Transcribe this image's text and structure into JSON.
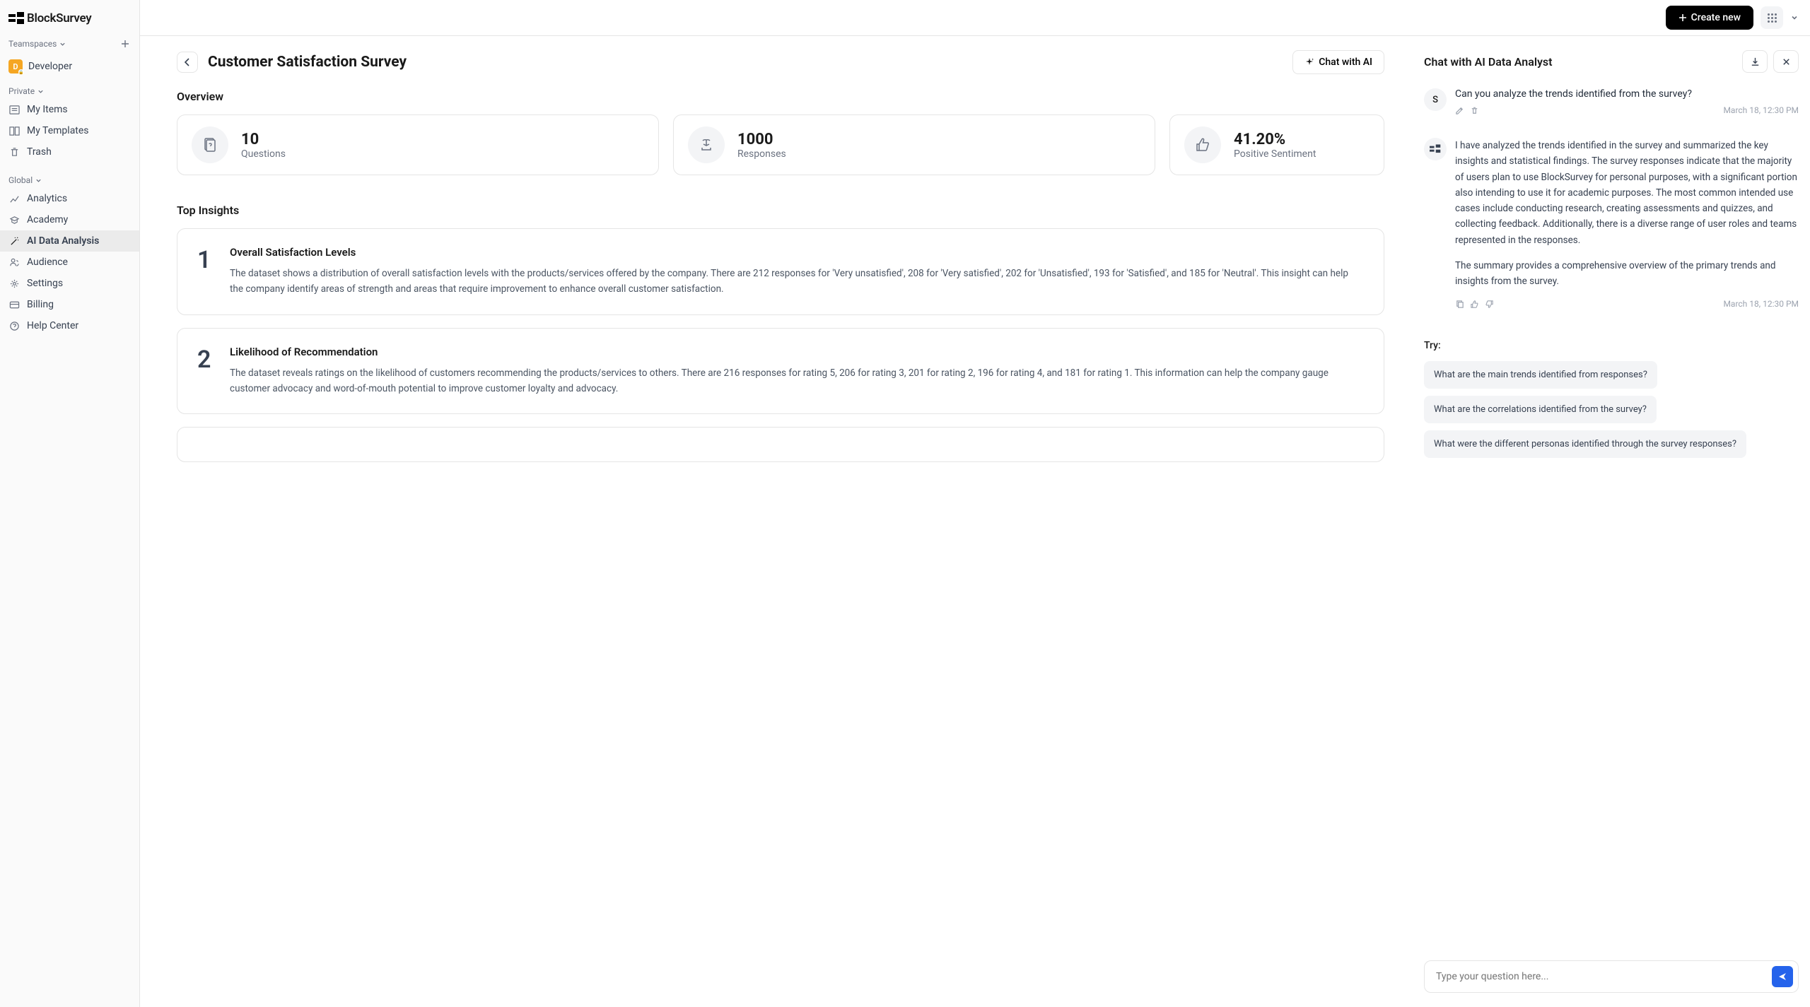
{
  "app": {
    "name": "BlockSurvey"
  },
  "topbar": {
    "create_label": "Create new"
  },
  "sidebar": {
    "teamspaces_label": "Teamspaces",
    "user": {
      "initial": "D",
      "name": "Developer"
    },
    "private_label": "Private",
    "private_items": [
      {
        "label": "My Items"
      },
      {
        "label": "My Templates"
      },
      {
        "label": "Trash"
      }
    ],
    "global_label": "Global",
    "global_items": [
      {
        "label": "Analytics"
      },
      {
        "label": "Academy"
      },
      {
        "label": "AI Data Analysis"
      },
      {
        "label": "Audience"
      },
      {
        "label": "Settings"
      },
      {
        "label": "Billing"
      },
      {
        "label": "Help Center"
      }
    ]
  },
  "page": {
    "title": "Customer Satisfaction Survey",
    "chat_btn": "Chat with AI",
    "overview_heading": "Overview",
    "stats": {
      "questions": {
        "value": "10",
        "label": "Questions"
      },
      "responses": {
        "value": "1000",
        "label": "Responses"
      },
      "sentiment": {
        "value": "41.20%",
        "label": "Positive Sentiment"
      }
    },
    "insights_heading": "Top Insights",
    "insights": [
      {
        "num": "1",
        "title": "Overall Satisfaction Levels",
        "body": "The dataset shows a distribution of overall satisfaction levels with the products/services offered by the company. There are 212 responses for 'Very unsatisfied', 208 for 'Very satisfied', 202 for 'Unsatisfied', 193 for 'Satisfied', and 185 for 'Neutral'. This insight can help the company identify areas of strength and areas that require improvement to enhance overall customer satisfaction."
      },
      {
        "num": "2",
        "title": "Likelihood of Recommendation",
        "body": "The dataset reveals ratings on the likelihood of customers recommending the products/services to others. There are 216 responses for rating 5, 206 for rating 3, 201 for rating 2, 196 for rating 4, and 181 for rating 1. This information can help the company gauge customer advocacy and word-of-mouth potential to improve customer loyalty and advocacy."
      }
    ]
  },
  "chat": {
    "title": "Chat with AI Data Analyst",
    "user_initial": "S",
    "user_msg": "Can you analyze the trends identified from the survey?",
    "user_time": "March 18, 12:30 PM",
    "ai_para1": "I have analyzed the trends identified in the survey and summarized the key insights and statistical findings. The survey responses indicate that the majority of users plan to use BlockSurvey for personal purposes, with a significant portion also intending to use it for academic purposes. The most common intended use cases include conducting research, creating assessments and quizzes, and collecting feedback. Additionally, there is a diverse range of user roles and teams represented in the responses.",
    "ai_para2": "The summary provides a comprehensive overview of the primary trends and insights from the survey.",
    "ai_time": "March 18, 12:30 PM",
    "try_label": "Try:",
    "try_items": [
      "What are the main trends identified from responses?",
      "What are the correlations identified from the survey?",
      "What were the different personas identified through the survey responses?"
    ],
    "input_placeholder": "Type your question here..."
  }
}
